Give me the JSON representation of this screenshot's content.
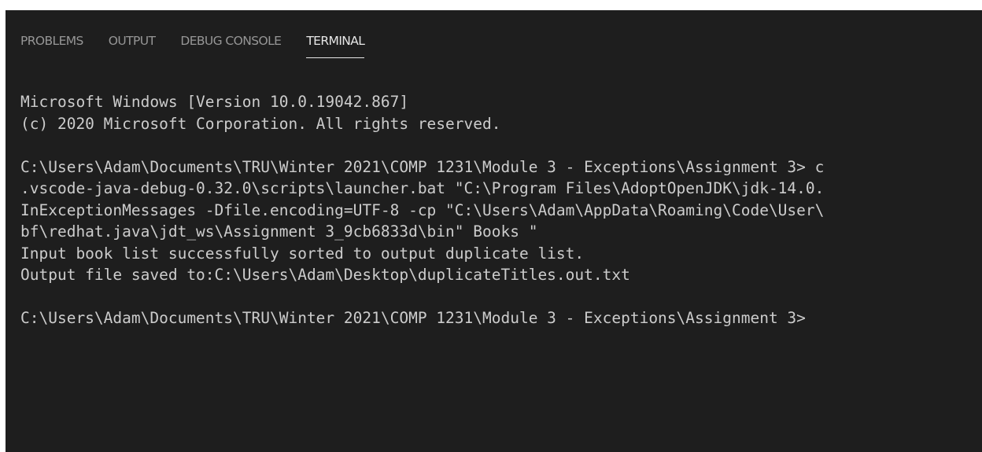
{
  "panel": {
    "tabs": [
      {
        "label": "PROBLEMS",
        "active": false
      },
      {
        "label": "OUTPUT",
        "active": false
      },
      {
        "label": "DEBUG CONSOLE",
        "active": false
      },
      {
        "label": "TERMINAL",
        "active": true
      }
    ]
  },
  "terminal": {
    "lines": [
      "Microsoft Windows [Version 10.0.19042.867]",
      "(c) 2020 Microsoft Corporation. All rights reserved.",
      "",
      "C:\\Users\\Adam\\Documents\\TRU\\Winter 2021\\COMP 1231\\Module 3 - Exceptions\\Assignment 3> c",
      ".vscode-java-debug-0.32.0\\scripts\\launcher.bat \"C:\\Program Files\\AdoptOpenJDK\\jdk-14.0.",
      "InExceptionMessages -Dfile.encoding=UTF-8 -cp \"C:\\Users\\Adam\\AppData\\Roaming\\Code\\User\\",
      "bf\\redhat.java\\jdt_ws\\Assignment 3_9cb6833d\\bin\" Books \"",
      "Input book list successfully sorted to output duplicate list.",
      "Output file saved to:C:\\Users\\Adam\\Desktop\\duplicateTitles.out.txt",
      "",
      "C:\\Users\\Adam\\Documents\\TRU\\Winter 2021\\COMP 1231\\Module 3 - Exceptions\\Assignment 3>"
    ]
  },
  "colors": {
    "panel_background": "#1e1e1e",
    "terminal_text": "#cccccc",
    "tab_inactive": "#969696",
    "tab_active": "#e7e7e7"
  }
}
